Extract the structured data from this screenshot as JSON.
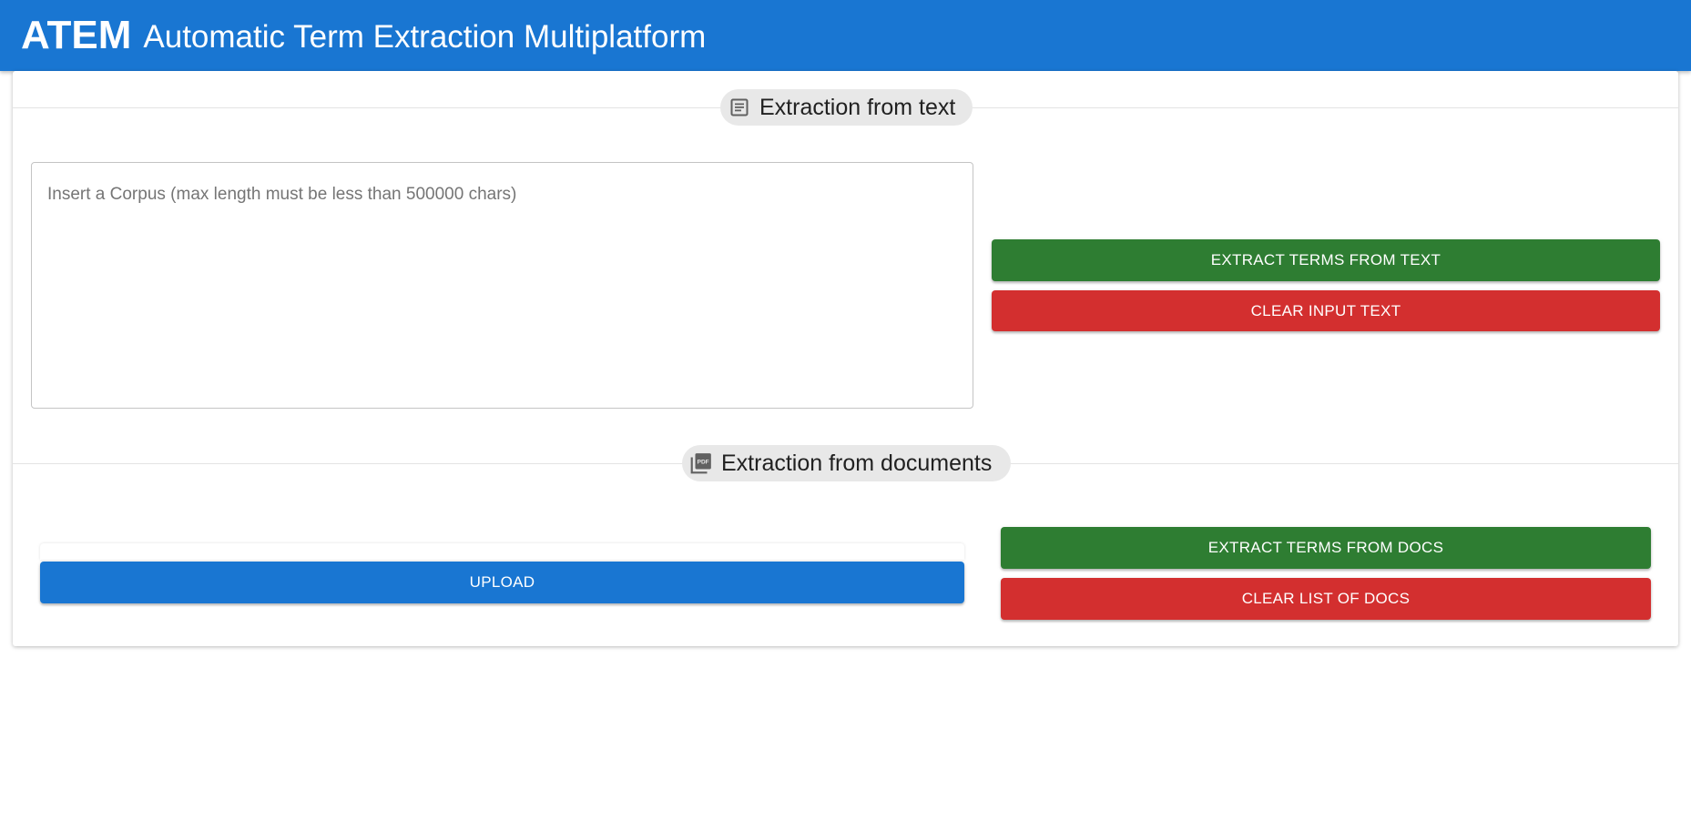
{
  "header": {
    "brand": "ATEM",
    "subtitle": "Automatic Term Extraction Multiplatform",
    "color": "#1976d2"
  },
  "text_section": {
    "title": "Extraction from text",
    "icon": "article-icon",
    "input_placeholder": "Insert a Corpus (max length must be less than 500000 chars)",
    "input_value": "",
    "extract_label": "EXTRACT TERMS FROM TEXT",
    "clear_label": "CLEAR INPUT TEXT"
  },
  "docs_section": {
    "title": "Extraction from documents",
    "icon": "pdf-icon",
    "upload_label": "UPLOAD",
    "extract_label": "EXTRACT TERMS FROM DOCS",
    "clear_label": "CLEAR LIST OF DOCS"
  },
  "colors": {
    "green": "#2e7d32",
    "red": "#d32f2f",
    "blue": "#1976d2"
  }
}
